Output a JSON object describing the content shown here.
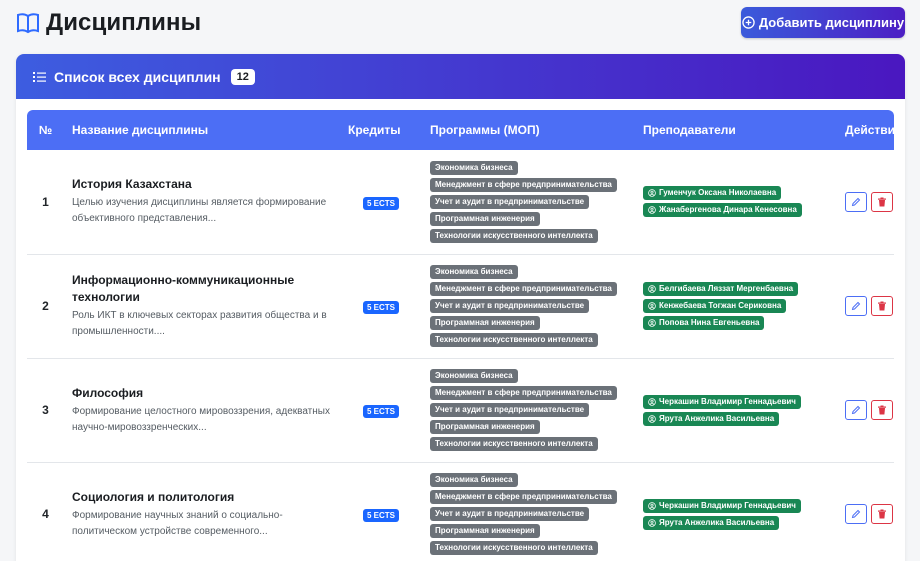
{
  "header": {
    "title": "Дисциплины",
    "add_button_label": "Добавить дисциплину"
  },
  "card": {
    "title": "Список всех дисциплин",
    "count": "12"
  },
  "table": {
    "columns": [
      "№",
      "Название дисциплины",
      "Кредиты",
      "Программы (МОП)",
      "Преподаватели",
      "Действия"
    ],
    "rows": [
      {
        "num": "1",
        "name": "История Казахстана",
        "desc": "Целью изучения дисциплины является формирование объективного представления...",
        "credits": "5 ECTS",
        "programs": [
          "Экономика бизнеса",
          "Менеджмент в сфере предпринимательства",
          "Учет и аудит в предпринимательстве",
          "Программная инженерия",
          "Технологии искусственного интеллекта"
        ],
        "teachers": [
          "Гуменчук Оксана Николаевна",
          "Жанабергенова Динара Кенесовна"
        ]
      },
      {
        "num": "2",
        "name": "Информационно-коммуникационные технологии",
        "desc": "Роль ИКТ в ключевых секторах развития общества и в промышленности....",
        "credits": "5 ECTS",
        "programs": [
          "Экономика бизнеса",
          "Менеджмент в сфере предпринимательства",
          "Учет и аудит в предпринимательстве",
          "Программная инженерия",
          "Технологии искусственного интеллекта"
        ],
        "teachers": [
          "Белгибаева Ляззат Мергенбаевна",
          "Кенжебаева Тогжан Сериковна",
          "Попова Нина Евгеньевна"
        ]
      },
      {
        "num": "3",
        "name": "Философия",
        "desc": "Формирование целостного мировоззрения, адекватных научно-мировоззренческих...",
        "credits": "5 ECTS",
        "programs": [
          "Экономика бизнеса",
          "Менеджмент в сфере предпринимательства",
          "Учет и аудит в предпринимательстве",
          "Программная инженерия",
          "Технологии искусственного интеллекта"
        ],
        "teachers": [
          "Черкашин Владимир Геннадьевич",
          "Ярута Анжелика Васильевна"
        ]
      },
      {
        "num": "4",
        "name": "Социология и политология",
        "desc": "Формирование научных знаний о социально-политическом устройстве современного...",
        "credits": "5 ECTS",
        "programs": [
          "Экономика бизнеса",
          "Менеджмент в сфере предпринимательства",
          "Учет и аудит в предпринимательстве",
          "Программная инженерия",
          "Технологии искусственного интеллекта"
        ],
        "teachers": [
          "Черкашин Владимир Геннадьевич",
          "Ярута Анжелика Васильевна"
        ]
      }
    ]
  },
  "colors": {
    "accent": "#4c6ef5",
    "header_gradient_start": "#3d5de0",
    "header_gradient_end": "#4a17c0",
    "program_badge": "#6b7178",
    "teacher_badge": "#198754",
    "ects_badge": "#1a66ff",
    "delete": "#dc3545"
  },
  "icons": {
    "title": "book-icon",
    "add": "plus-circle-icon",
    "list": "list-icon",
    "teacher": "user-circle-icon",
    "edit": "pencil-icon",
    "delete": "trash-icon"
  }
}
